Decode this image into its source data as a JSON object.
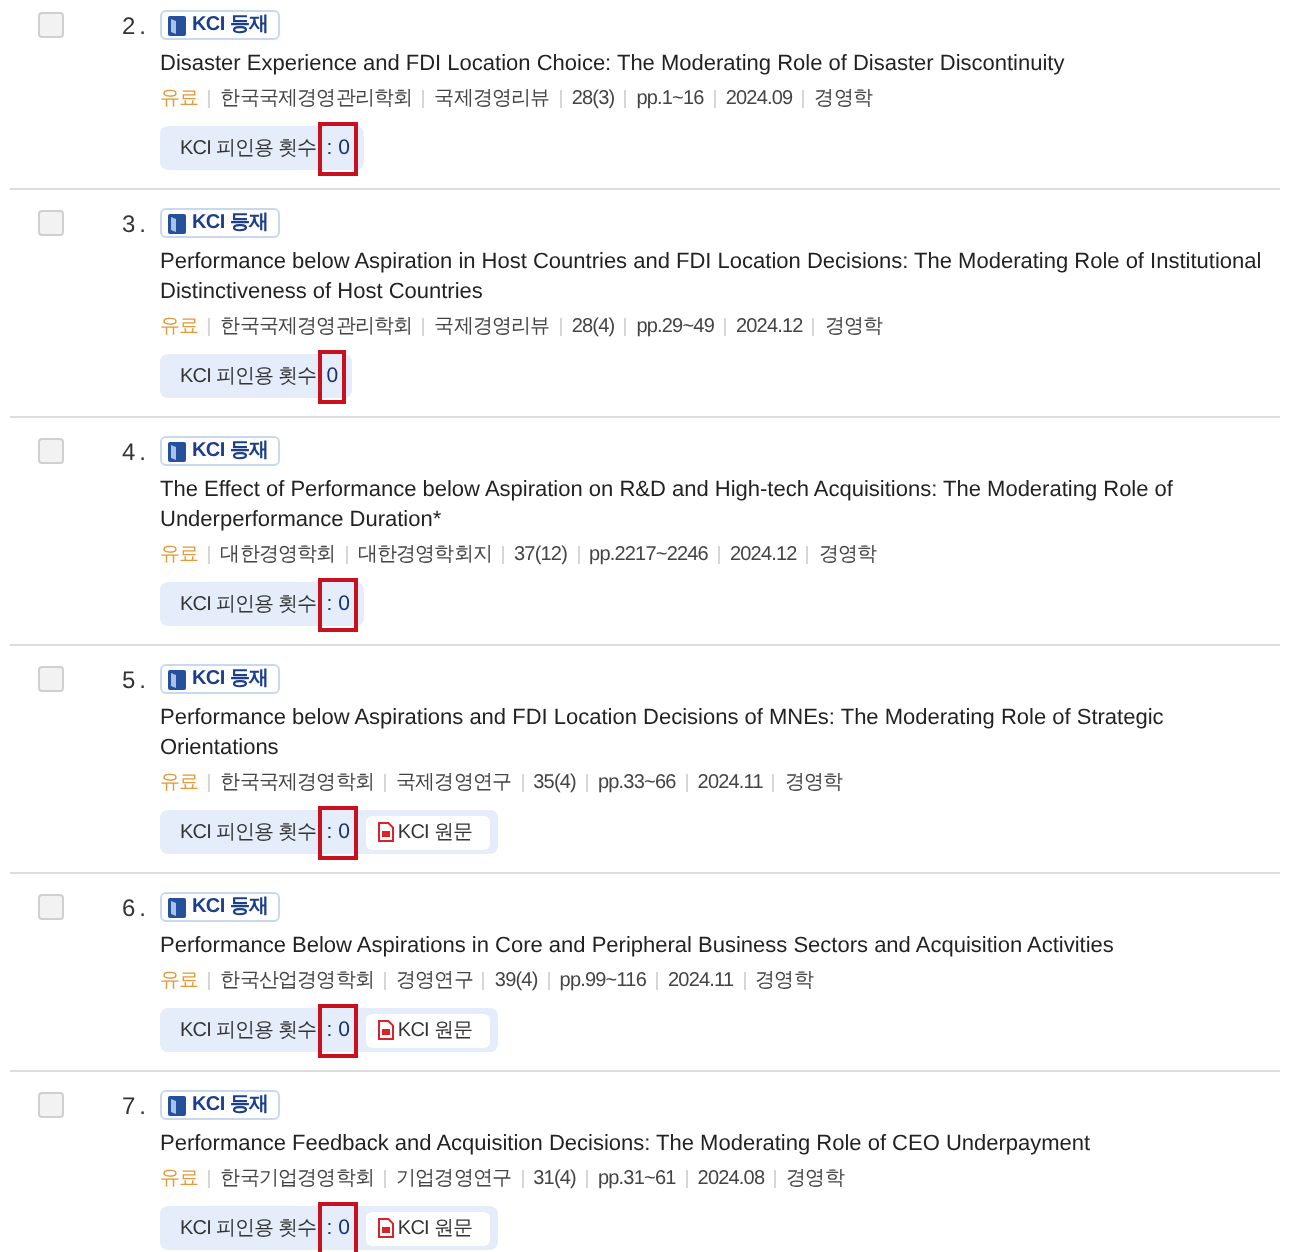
{
  "items": [
    {
      "number": "2.",
      "checked": false,
      "badge": "KCI 등재",
      "title": "Disaster Experience and FDI Location Choice: The Moderating Role of Disaster Discontinuity",
      "access": "유료",
      "publisher": "한국국제경영관리학회",
      "journal": "국제경영리뷰",
      "volume": "28(3)",
      "pages": "pp.1~16",
      "date": "2024.09",
      "subject": "경영학",
      "citations": {
        "label": "KCI 피인용 횟수",
        "count": ": 0",
        "highlighted": true
      }
    },
    {
      "number": "3.",
      "checked": false,
      "badge": "KCI 등재",
      "title": "Performance below Aspiration in Host Countries and FDI Location Decisions: The Moderating Role of Institutional Distinctiveness of Host Countries",
      "access": "유료",
      "publisher": "한국국제경영관리학회",
      "journal": "국제경영리뷰",
      "volume": "28(4)",
      "pages": "pp.29~49",
      "date": "2024.12",
      "subject": "경영학",
      "citations": {
        "label": "KCI 피인용 횟수",
        "count": "0",
        "highlighted": true
      }
    },
    {
      "number": "4.",
      "checked": false,
      "badge": "KCI 등재",
      "title": "The Effect of Performance below Aspiration on R&D and High-tech Acquisitions: The Moderating Role of Underperformance Duration*",
      "access": "유료",
      "publisher": "대한경영학회",
      "journal": "대한경영학회지",
      "volume": "37(12)",
      "pages": "pp.2217~2246",
      "date": "2024.12",
      "subject": "경영학",
      "citations": {
        "label": "KCI 피인용 횟수",
        "count": ": 0",
        "highlighted": true
      }
    },
    {
      "number": "5.",
      "checked": false,
      "badge": "KCI 등재",
      "title": "Performance below Aspirations and FDI Location Decisions of MNEs: The Moderating Role of Strategic Orientations",
      "access": "유료",
      "publisher": "한국국제경영학회",
      "journal": "국제경영연구",
      "volume": "35(4)",
      "pages": "pp.33~66",
      "date": "2024.11",
      "subject": "경영학",
      "citations": {
        "label": "KCI 피인용 횟수",
        "count": ": 0",
        "highlighted": true
      },
      "full_text": "KCI 원문"
    },
    {
      "number": "6.",
      "checked": false,
      "badge": "KCI 등재",
      "title": "Performance Below Aspirations in Core and Peripheral Business Sectors and Acquisition Activities",
      "access": "유료",
      "publisher": "한국산업경영학회",
      "journal": "경영연구",
      "volume": "39(4)",
      "pages": "pp.99~116",
      "date": "2024.11",
      "subject": "경영학",
      "citations": {
        "label": "KCI 피인용 횟수",
        "count": ": 0",
        "highlighted": true
      },
      "full_text": "KCI 원문"
    },
    {
      "number": "7.",
      "checked": false,
      "badge": "KCI 등재",
      "title": "Performance Feedback and Acquisition Decisions: The Moderating Role of CEO Underpayment",
      "access": "유료",
      "publisher": "한국기업경영학회",
      "journal": "기업경영연구",
      "volume": "31(4)",
      "pages": "pp.31~61",
      "date": "2024.08",
      "subject": "경영학",
      "citations": {
        "label": "KCI 피인용 횟수",
        "count": ": 0",
        "highlighted": true
      },
      "full_text": "KCI 원문"
    }
  ]
}
